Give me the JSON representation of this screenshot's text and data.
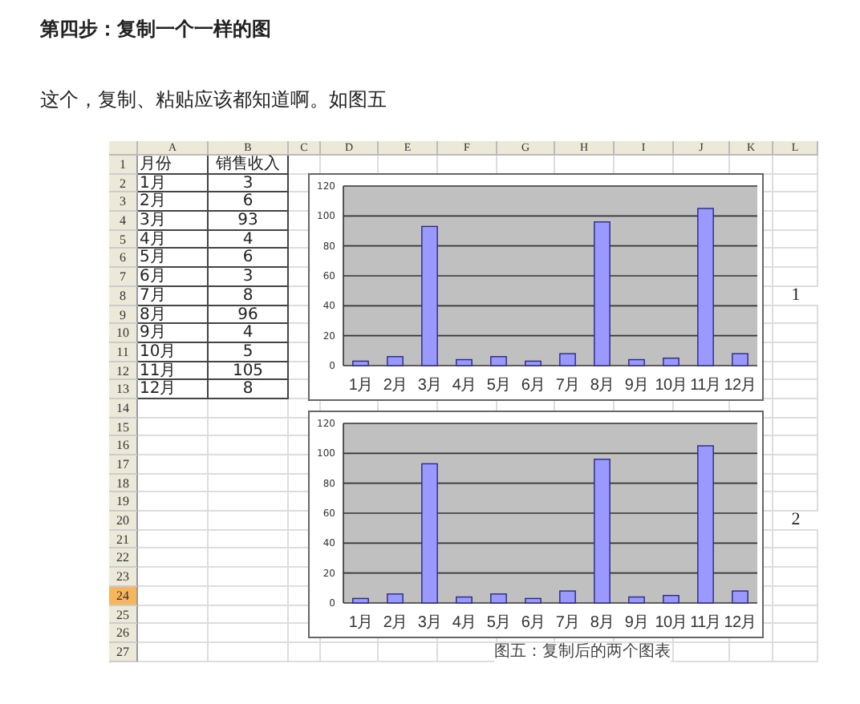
{
  "heading": "第四步：复制一个一样的图",
  "paragraph": "这个，复制、粘贴应该都知道啊。如图五",
  "sheet": {
    "columns": [
      "A",
      "B",
      "C",
      "D",
      "E",
      "F",
      "G",
      "H",
      "I",
      "J",
      "K",
      "L"
    ],
    "rows": [
      {
        "number": "1",
        "selected": false,
        "cells": [
          "月份",
          "销售收入"
        ]
      },
      {
        "number": "2",
        "selected": false,
        "cells": [
          "1月",
          "3"
        ]
      },
      {
        "number": "3",
        "selected": false,
        "cells": [
          "2月",
          "6"
        ]
      },
      {
        "number": "4",
        "selected": false,
        "cells": [
          "3月",
          "93"
        ]
      },
      {
        "number": "5",
        "selected": false,
        "cells": [
          "4月",
          "4"
        ]
      },
      {
        "number": "6",
        "selected": false,
        "cells": [
          "5月",
          "6"
        ]
      },
      {
        "number": "7",
        "selected": false,
        "cells": [
          "6月",
          "3"
        ]
      },
      {
        "number": "8",
        "selected": false,
        "cells": [
          "7月",
          "8"
        ],
        "note": "1"
      },
      {
        "number": "9",
        "selected": false,
        "cells": [
          "8月",
          "96"
        ]
      },
      {
        "number": "10",
        "selected": false,
        "cells": [
          "9月",
          "4"
        ]
      },
      {
        "number": "11",
        "selected": false,
        "cells": [
          "10月",
          "5"
        ]
      },
      {
        "number": "12",
        "selected": false,
        "cells": [
          "11月",
          "105"
        ]
      },
      {
        "number": "13",
        "selected": false,
        "cells": [
          "12月",
          "8"
        ]
      },
      {
        "number": "14",
        "selected": false
      },
      {
        "number": "15",
        "selected": false
      },
      {
        "number": "16",
        "selected": false
      },
      {
        "number": "17",
        "selected": false
      },
      {
        "number": "18",
        "selected": false
      },
      {
        "number": "19",
        "selected": false
      },
      {
        "number": "20",
        "selected": false,
        "note": "2"
      },
      {
        "number": "21",
        "selected": false
      },
      {
        "number": "22",
        "selected": false
      },
      {
        "number": "23",
        "selected": false
      },
      {
        "number": "24",
        "selected": true
      },
      {
        "number": "25",
        "selected": false
      },
      {
        "number": "26",
        "selected": false
      },
      {
        "number": "27",
        "selected": false
      }
    ]
  },
  "charts": [
    {
      "chart_data": {
        "type": "bar",
        "categories": [
          "1月",
          "2月",
          "3月",
          "4月",
          "5月",
          "6月",
          "7月",
          "8月",
          "9月",
          "10月",
          "11月",
          "12月"
        ],
        "series": [
          {
            "color": "#9999ff",
            "values": [
              3,
              6,
              93,
              4,
              6,
              3,
              8,
              96,
              4,
              5,
              105,
              8
            ]
          }
        ],
        "ylim": [
          0,
          120
        ],
        "yticks": [
          0,
          20,
          40,
          60,
          80,
          100,
          120
        ],
        "grid": true
      }
    },
    {
      "chart_data": {
        "type": "bar",
        "categories": [
          "1月",
          "2月",
          "3月",
          "4月",
          "5月",
          "6月",
          "7月",
          "8月",
          "9月",
          "10月",
          "11月",
          "12月"
        ],
        "series": [
          {
            "color": "#9999ff",
            "values": [
              3,
              6,
              93,
              4,
              6,
              3,
              8,
              96,
              4,
              5,
              105,
              8
            ]
          }
        ],
        "ylim": [
          0,
          120
        ],
        "yticks": [
          0,
          20,
          40,
          60,
          80,
          100,
          120
        ],
        "grid": true
      }
    }
  ],
  "caption": "图五：复制后的两个图表"
}
